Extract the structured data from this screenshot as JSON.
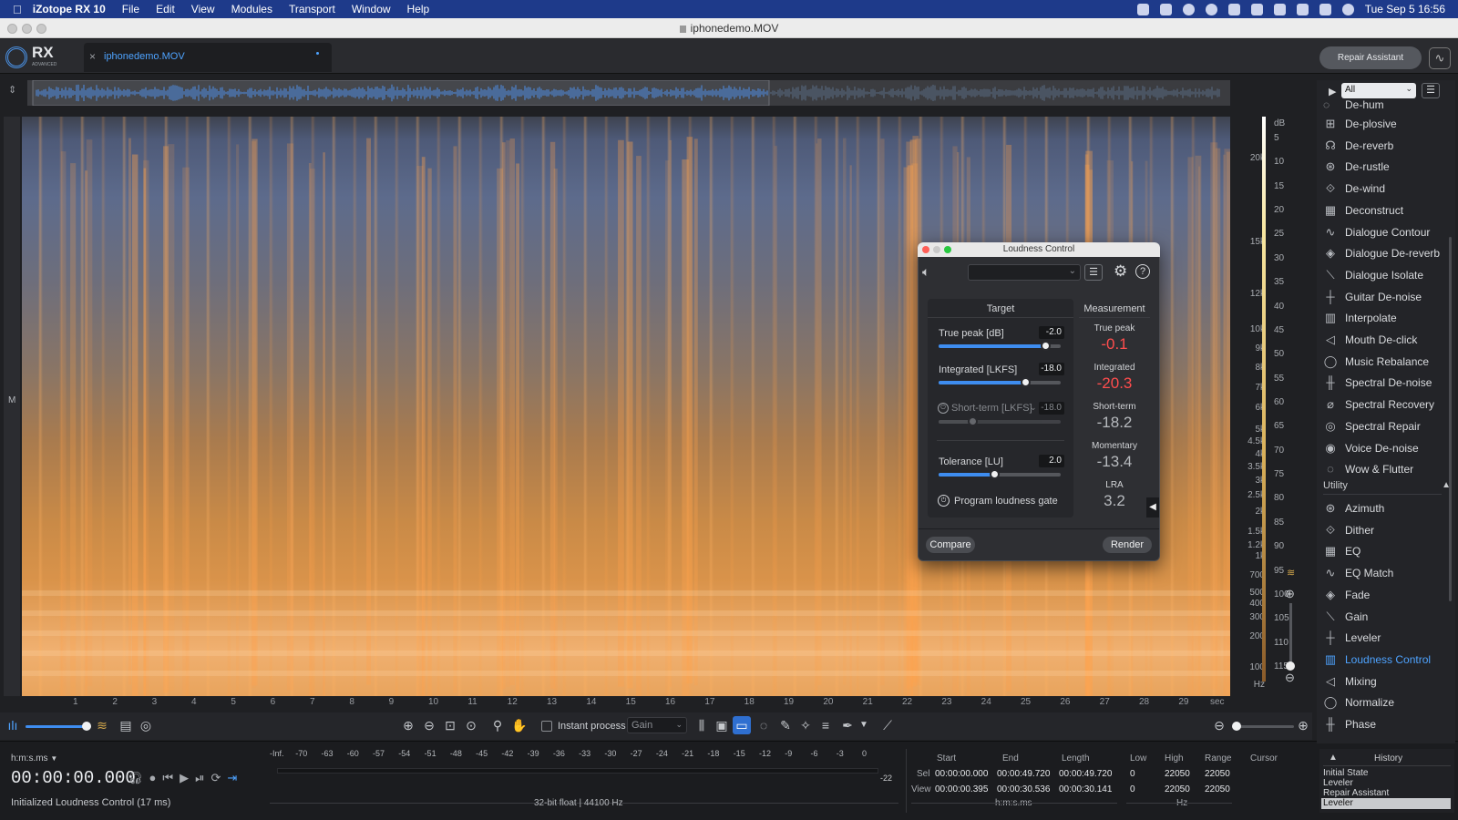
{
  "menubar": {
    "app": "iZotope RX 10",
    "items": [
      "File",
      "Edit",
      "View",
      "Modules",
      "Transport",
      "Window",
      "Help"
    ],
    "clock": "Tue Sep 5  16:56"
  },
  "window": {
    "title": "iphonedemo.MOV"
  },
  "header": {
    "logo": "RX",
    "logo_sub": "ADVANCED",
    "tab_name": "iphonedemo.MOV",
    "repair_assistant": "Repair Assistant"
  },
  "spectrogram": {
    "channel_label": "M",
    "freq_unit": "Hz",
    "freq_ticks": [
      "20k",
      "15k",
      "12k",
      "10k",
      "9k",
      "8k",
      "7k",
      "6k",
      "5k",
      "4.5k",
      "4k",
      "3.5k",
      "3k",
      "2.5k",
      "2k",
      "1.5k",
      "1.2k",
      "1k",
      "700",
      "500",
      "400",
      "300",
      "200",
      "100"
    ],
    "db_unit": "dB",
    "db_ticks": [
      "5",
      "10",
      "15",
      "20",
      "25",
      "30",
      "35",
      "40",
      "45",
      "50",
      "55",
      "60",
      "65",
      "70",
      "75",
      "80",
      "85",
      "90",
      "95",
      "100",
      "105",
      "110",
      "115"
    ],
    "time_ticks": [
      "1",
      "2",
      "3",
      "4",
      "5",
      "6",
      "7",
      "8",
      "9",
      "10",
      "11",
      "12",
      "13",
      "14",
      "15",
      "16",
      "17",
      "18",
      "19",
      "20",
      "21",
      "22",
      "23",
      "24",
      "25",
      "26",
      "27",
      "28",
      "29"
    ],
    "time_unit": "sec"
  },
  "toolbar": {
    "instant_process": "Instant process",
    "gain_select": "Gain"
  },
  "transport": {
    "time_format": "h:m:s.ms",
    "timecode": "00:00:00.000",
    "status": "Initialized Loudness Control (17 ms)",
    "format_info": "32-bit float | 44100 Hz"
  },
  "meter": {
    "ticks": [
      "-Inf.",
      "-70",
      "-63",
      "-60",
      "-57",
      "-54",
      "-51",
      "-48",
      "-45",
      "-42",
      "-39",
      "-36",
      "-33",
      "-30",
      "-27",
      "-24",
      "-21",
      "-18",
      "-15",
      "-12",
      "-9",
      "-6",
      "-3",
      "0"
    ],
    "peak_label": "-22"
  },
  "selection": {
    "headers": [
      "Start",
      "End",
      "Length"
    ],
    "sel_label": "Sel",
    "view_label": "View",
    "sel": [
      "00:00:00.000",
      "00:00:49.720",
      "00:00:49.720"
    ],
    "view": [
      "00:00:00.395",
      "00:00:30.536",
      "00:00:30.141"
    ],
    "unit": "h:m:s.ms",
    "hz_headers": [
      "Low",
      "High",
      "Range"
    ],
    "hz_sel": [
      "0",
      "22050",
      "22050"
    ],
    "hz_view": [
      "0",
      "22050",
      "22050"
    ],
    "hz_unit": "Hz",
    "cursor_label": "Cursor"
  },
  "modules": {
    "filter": "All",
    "partial_top": "De-hum",
    "items": [
      {
        "label": "De-plosive",
        "icon": "de-plosive-icon"
      },
      {
        "label": "De-reverb",
        "icon": "de-reverb-icon"
      },
      {
        "label": "De-rustle",
        "icon": "de-rustle-icon"
      },
      {
        "label": "De-wind",
        "icon": "de-wind-icon"
      },
      {
        "label": "Deconstruct",
        "icon": "deconstruct-icon"
      },
      {
        "label": "Dialogue Contour",
        "icon": "dialogue-contour-icon"
      },
      {
        "label": "Dialogue De-reverb",
        "icon": "dialogue-de-reverb-icon"
      },
      {
        "label": "Dialogue Isolate",
        "icon": "dialogue-isolate-icon"
      },
      {
        "label": "Guitar De-noise",
        "icon": "guitar-de-noise-icon"
      },
      {
        "label": "Interpolate",
        "icon": "interpolate-icon"
      },
      {
        "label": "Mouth De-click",
        "icon": "mouth-de-click-icon"
      },
      {
        "label": "Music Rebalance",
        "icon": "music-rebalance-icon"
      },
      {
        "label": "Spectral De-noise",
        "icon": "spectral-de-noise-icon"
      },
      {
        "label": "Spectral Recovery",
        "icon": "spectral-recovery-icon"
      },
      {
        "label": "Spectral Repair",
        "icon": "spectral-repair-icon"
      },
      {
        "label": "Voice De-noise",
        "icon": "voice-de-noise-icon"
      },
      {
        "label": "Wow & Flutter",
        "icon": "wow-flutter-icon"
      }
    ],
    "utility_header": "Utility",
    "utility": [
      {
        "label": "Azimuth",
        "icon": "azimuth-icon"
      },
      {
        "label": "Dither",
        "icon": "dither-icon"
      },
      {
        "label": "EQ",
        "icon": "eq-icon"
      },
      {
        "label": "EQ Match",
        "icon": "eq-match-icon"
      },
      {
        "label": "Fade",
        "icon": "fade-icon"
      },
      {
        "label": "Gain",
        "icon": "gain-icon"
      },
      {
        "label": "Leveler",
        "icon": "leveler-icon"
      },
      {
        "label": "Loudness Control",
        "icon": "loudness-control-icon",
        "active": true
      },
      {
        "label": "Mixing",
        "icon": "mixing-icon"
      },
      {
        "label": "Normalize",
        "icon": "normalize-icon"
      },
      {
        "label": "Phase",
        "icon": "phase-icon"
      }
    ]
  },
  "history": {
    "title": "History",
    "items": [
      "Initial State",
      "Leveler",
      "Repair Assistant",
      "Leveler"
    ]
  },
  "loudness": {
    "title": "Loudness Control",
    "target_header": "Target",
    "measurement_header": "Measurement",
    "true_peak_label": "True peak [dB]",
    "true_peak_value": "-2.0",
    "true_peak_level": 0.88,
    "integrated_label": "Integrated [LKFS]",
    "integrated_value": "-18.0",
    "integrated_level": 0.72,
    "short_term_label": "Short-term [LKFS]",
    "short_term_value": "-18.0",
    "short_term_level": 0.28,
    "tolerance_label": "Tolerance [LU]",
    "tolerance_value": "2.0",
    "tolerance_level": 0.46,
    "gate_label": "Program loudness gate",
    "m_true_peak_label": "True peak",
    "m_true_peak": "-0.1",
    "m_integrated_label": "Integrated",
    "m_integrated": "-20.3",
    "m_short_term_label": "Short-term",
    "m_short_term": "-18.2",
    "m_momentary_label": "Momentary",
    "m_momentary": "-13.4",
    "m_lra_label": "LRA",
    "m_lra": "3.2",
    "compare": "Compare",
    "render": "Render"
  }
}
